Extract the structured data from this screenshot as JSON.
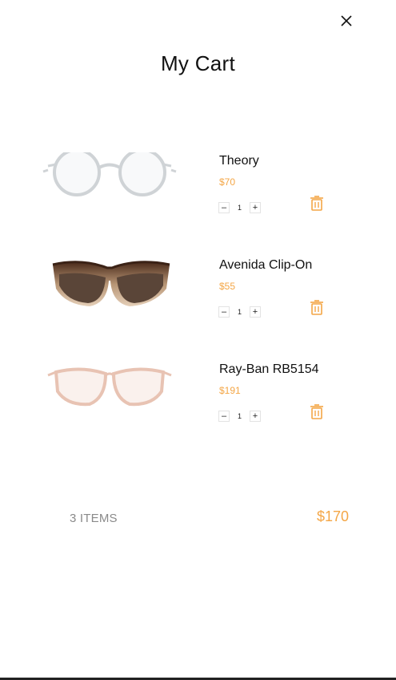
{
  "header": {
    "title": "My Cart",
    "close_icon": "close-icon"
  },
  "items": [
    {
      "name": "Theory",
      "price": "$70",
      "quantity": "1",
      "frame": "clear round frames"
    },
    {
      "name": "Avenida Clip-On",
      "price": "$55",
      "quantity": "1",
      "frame": "tortoise cat-eye sunglasses"
    },
    {
      "name": "Ray-Ban RB5154",
      "price": "$191",
      "quantity": "1",
      "frame": "blush clear cat-eye frames"
    }
  ],
  "controls": {
    "decrement_label": "–",
    "increment_label": "+",
    "remove_icon": "trash-icon"
  },
  "summary": {
    "count_label": "3 ITEMS",
    "total": "$170"
  },
  "colors": {
    "accent": "#f4a646",
    "text": "#111111",
    "muted": "#8a8a8a"
  }
}
